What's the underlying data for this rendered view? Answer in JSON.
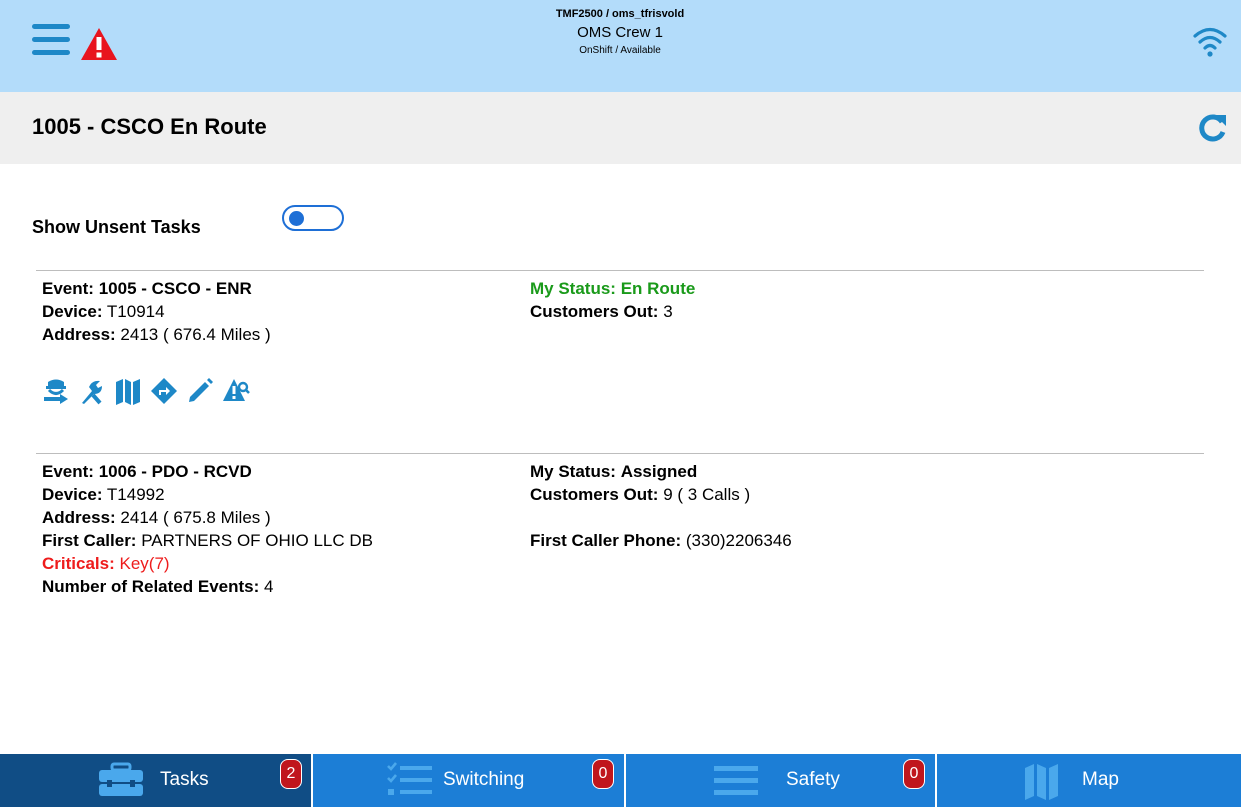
{
  "header": {
    "user": "TMF2500 / oms_tfrisvold",
    "crew": "OMS Crew 1",
    "shift_status": "OnShift / Available"
  },
  "page": {
    "title": "1005 - CSCO En Route"
  },
  "toggle": {
    "label": "Show Unsent Tasks",
    "on": false
  },
  "tasks": [
    {
      "event_label": "Event:",
      "event_value": "1005 - CSCO - ENR",
      "status_label": "My Status:",
      "status_value": "En Route",
      "device_label": "Device:",
      "device_value": "T10914",
      "customers_label": "Customers Out:",
      "customers_value": "3",
      "address_label": "Address:",
      "address_value": "2413 ( 676.4 Miles )",
      "actions": [
        "crew-arrive-icon",
        "wrench-icon",
        "map-icon",
        "directions-icon",
        "edit-icon",
        "hazard-search-icon"
      ]
    },
    {
      "event_label": "Event:",
      "event_value": "1006 - PDO - RCVD",
      "status_label": "My Status:",
      "status_value": "Assigned",
      "device_label": "Device:",
      "device_value": "T14992",
      "customers_label": "Customers Out:",
      "customers_value": "9 ( 3 Calls )",
      "address_label": "Address:",
      "address_value": "2414 ( 675.8 Miles )",
      "caller_label": "First Caller:",
      "caller_value": "PARTNERS OF OHIO LLC DB",
      "phone_label": "First Caller Phone:",
      "phone_value": "(330)2206346",
      "criticals_label": "Criticals:",
      "criticals_value": "Key(7)",
      "related_label": "Number of Related Events:",
      "related_value": "4"
    }
  ],
  "bottom_nav": [
    {
      "label": "Tasks",
      "badge": "2",
      "icon": "toolbox-icon",
      "active": true
    },
    {
      "label": "Switching",
      "badge": "0",
      "icon": "checklist-icon",
      "active": false
    },
    {
      "label": "Safety",
      "badge": "0",
      "icon": "list-icon",
      "active": false
    },
    {
      "label": "Map",
      "badge": "",
      "icon": "map-icon",
      "active": false
    }
  ],
  "colors": {
    "header_bg": "#b3dcfa",
    "accent": "#1e88c7",
    "status_green": "#1a9a1a",
    "critical_red": "#ee1c1c",
    "nav_bg": "#1c7ed6",
    "nav_active": "#104d85",
    "badge_red": "#c0161d"
  }
}
